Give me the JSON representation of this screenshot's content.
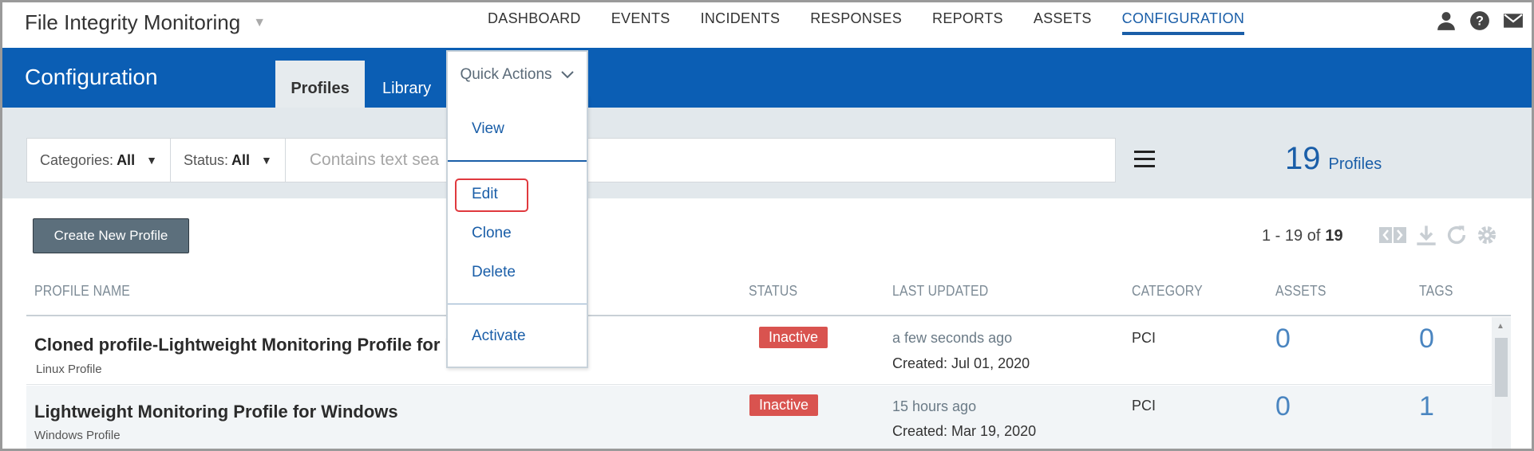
{
  "app": {
    "title": "File Integrity Monitoring"
  },
  "nav": [
    "DASHBOARD",
    "EVENTS",
    "INCIDENTS",
    "RESPONSES",
    "REPORTS",
    "ASSETS",
    "CONFIGURATION"
  ],
  "nav_active": "CONFIGURATION",
  "header": {
    "title": "Configuration",
    "tabs": {
      "profiles": "Profiles",
      "library": "Library"
    }
  },
  "quick_actions": {
    "label": "Quick Actions",
    "items": {
      "view": "View",
      "edit": "Edit",
      "clone": "Clone",
      "delete": "Delete",
      "activate": "Activate"
    }
  },
  "filters": {
    "categories_label": "Categories:",
    "categories_value": "All",
    "status_label": "Status:",
    "status_value": "All",
    "search_placeholder": "Contains text sea"
  },
  "summary": {
    "count": "19",
    "count_label": "Profiles"
  },
  "toolbar": {
    "create_label": "Create New Profile",
    "range": "1 - 19 of",
    "total": "19"
  },
  "table": {
    "headers": {
      "name": "PROFILE NAME",
      "status": "STATUS",
      "updated": "LAST UPDATED",
      "category": "CATEGORY",
      "assets": "ASSETS",
      "tags": "TAGS"
    },
    "rows": [
      {
        "name": "Cloned profile-Lightweight Monitoring Profile for Li",
        "sub": "Linux Profile",
        "status": "Inactive",
        "updated": "a few seconds ago",
        "created": "Created: Jul 01, 2020",
        "category": "PCI",
        "assets": "0",
        "tags": "0"
      },
      {
        "name": "Lightweight Monitoring Profile for Windows",
        "sub": "Windows Profile",
        "status": "Inactive",
        "updated": "15 hours ago",
        "created": "Created: Mar 19, 2020",
        "category": "PCI",
        "assets": "0",
        "tags": "1"
      }
    ]
  },
  "colors": {
    "primary": "#0b5eb4",
    "link": "#1a5ea8",
    "inactive": "#d9534f",
    "highlight": "#e0393e"
  },
  "icons": [
    "user-icon",
    "help-icon",
    "mail-icon",
    "hamburger-icon",
    "pager-arrows-icon",
    "download-icon",
    "refresh-icon",
    "settings-icon"
  ]
}
